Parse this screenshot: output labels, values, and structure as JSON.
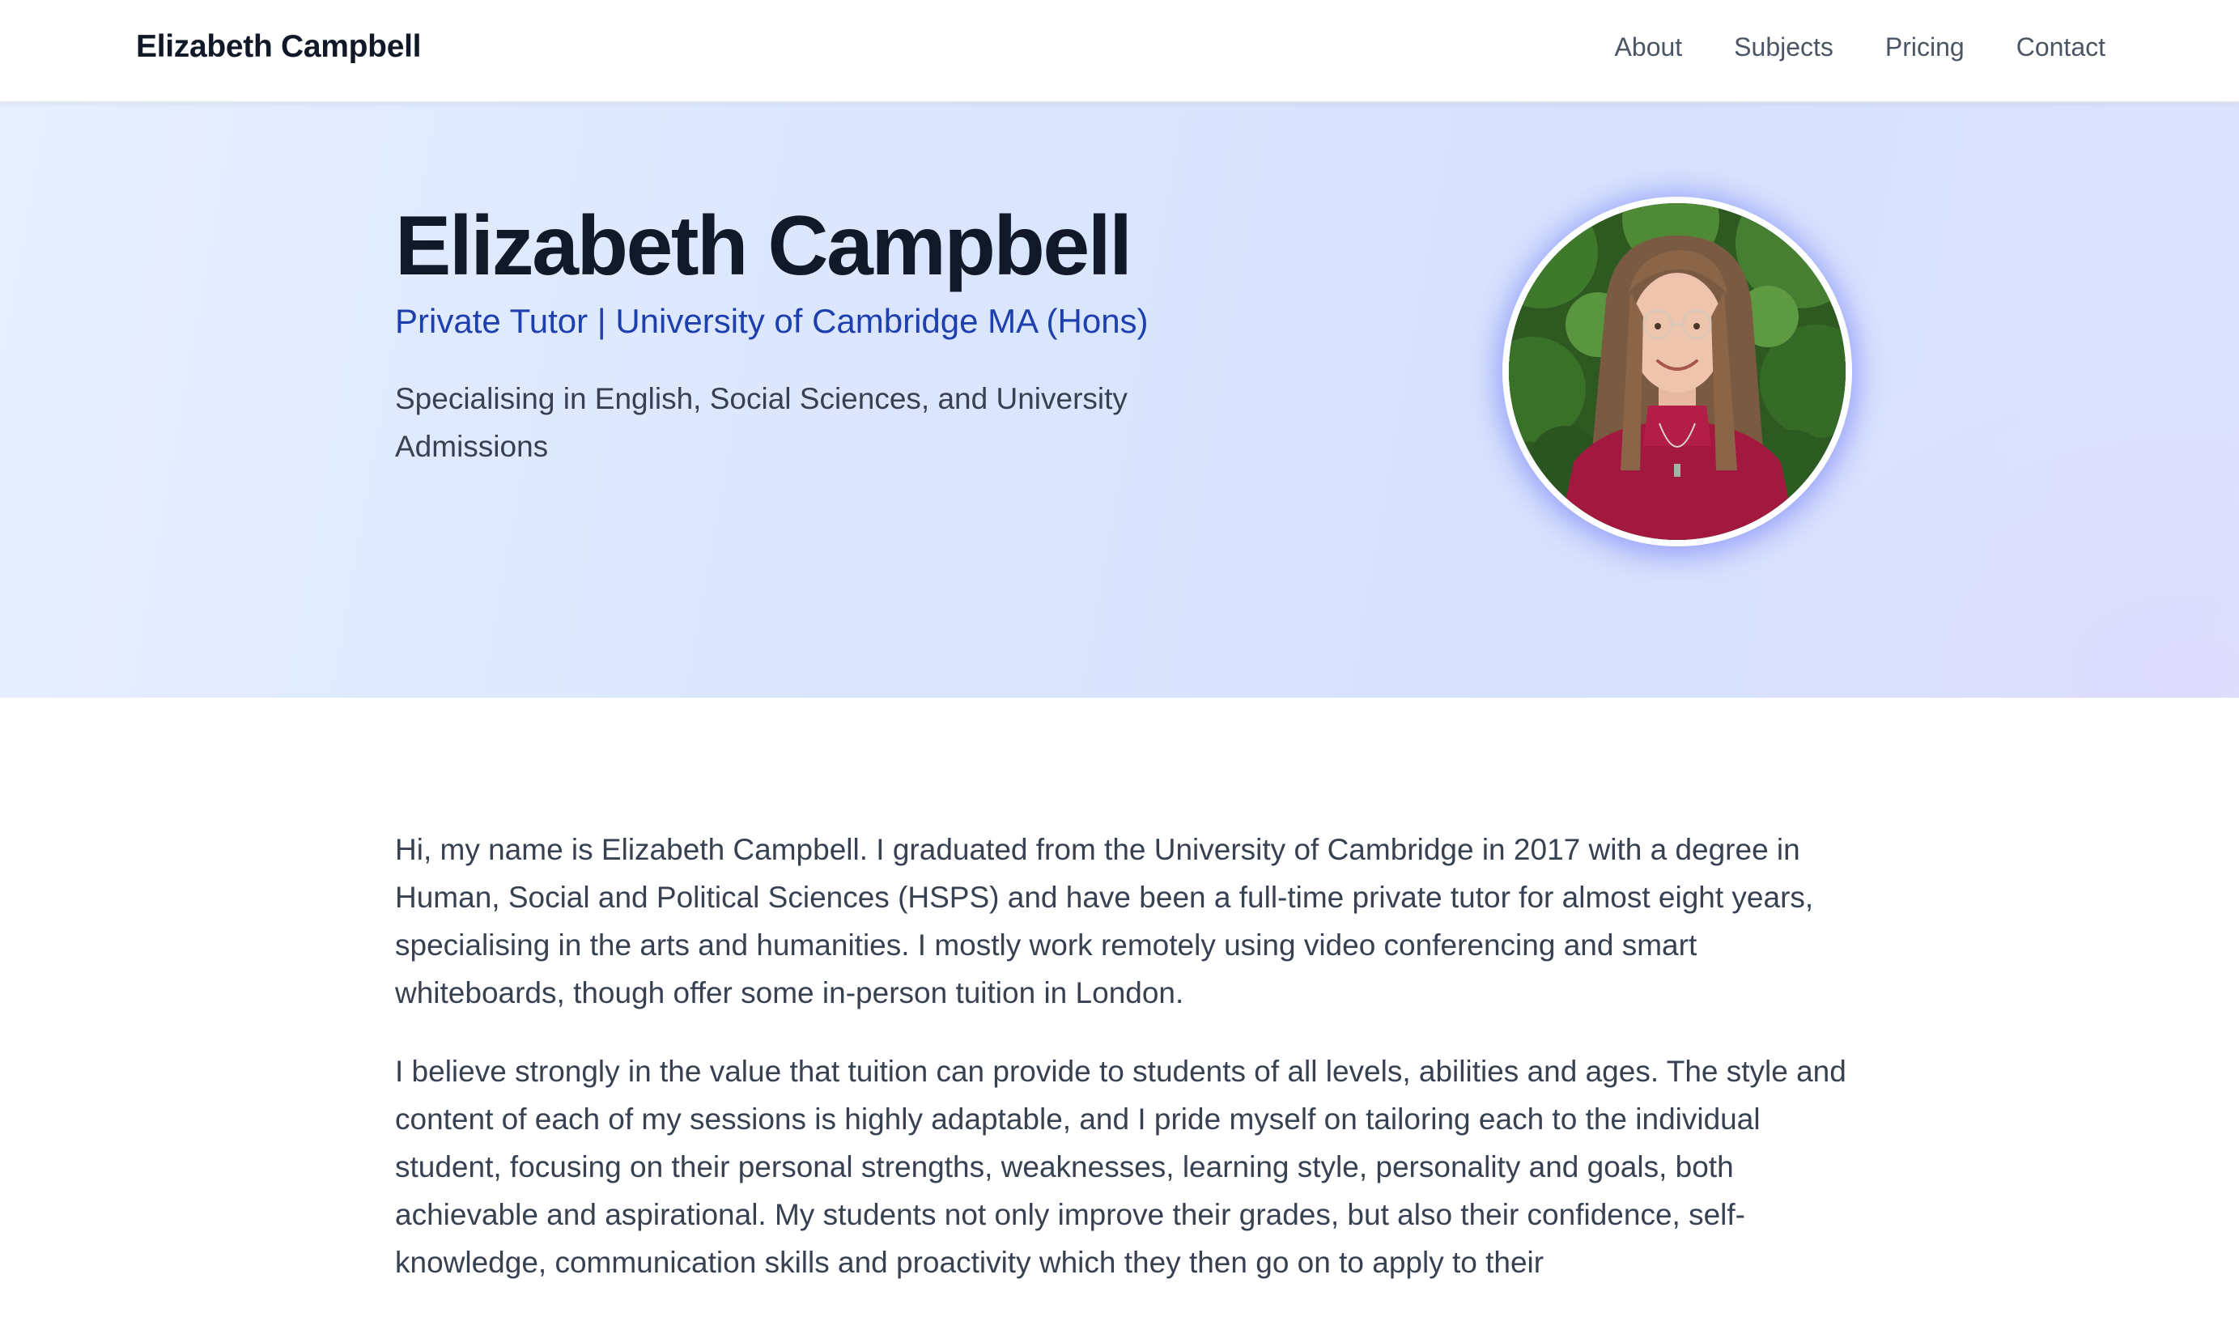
{
  "nav": {
    "brand": "Elizabeth Campbell",
    "links": [
      "About",
      "Subjects",
      "Pricing",
      "Contact"
    ]
  },
  "hero": {
    "name": "Elizabeth Campbell",
    "subtitle": "Private Tutor | University of Cambridge MA (Hons)",
    "tagline": "Specialising in English, Social Sciences, and University Admissions"
  },
  "about": {
    "paragraphs": [
      "Hi, my name is Elizabeth Campbell. I graduated from the University of Cambridge in 2017 with a degree in Human, Social and Political Sciences (HSPS) and have been a full-time private tutor for almost eight years, specialising in the arts and humanities. I mostly work remotely using video conferencing and smart whiteboards, though offer some in-person tuition in London.",
      "I believe strongly in the value that tuition can provide to students of all levels, abilities and ages. The style and content of each of my sessions is highly adaptable, and I pride myself on tailoring each to the individual student, focusing on their personal strengths, weaknesses, learning style, personality and goals, both achievable and aspirational. My students not only improve their grades, but also their confidence, self-knowledge, communication skills and proactivity which they then go on to apply to their"
    ]
  },
  "colors": {
    "accent": "#1e40af",
    "heading": "#111827",
    "body_text": "#374151",
    "nav_text": "#4b5563"
  }
}
